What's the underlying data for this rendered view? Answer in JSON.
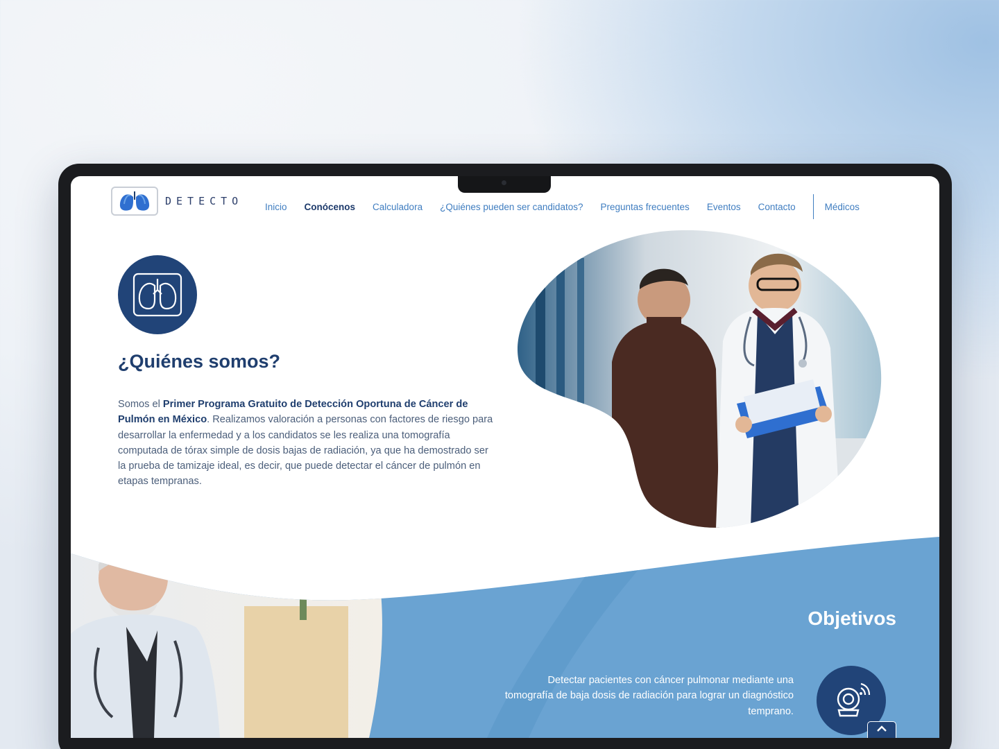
{
  "nav": {
    "brand": "DETECTO",
    "items": [
      {
        "label": "Inicio",
        "active": false
      },
      {
        "label": "Conócenos",
        "active": true
      },
      {
        "label": "Calculadora",
        "active": false
      },
      {
        "label": "¿Quiénes pueden ser candidatos?",
        "active": false
      },
      {
        "label": "Preguntas frecuentes",
        "active": false
      },
      {
        "label": "Eventos",
        "active": false
      },
      {
        "label": "Contacto",
        "active": false
      }
    ],
    "medicos": "Médicos"
  },
  "about": {
    "icon": "lungs-icon",
    "title": "¿Quiénes somos?",
    "text_intro": "Somos el ",
    "text_bold": "Primer Programa Gratuito de Detección Oportuna de Cáncer de Pulmón en México",
    "text_rest": ". Realizamos valoración a personas con factores de riesgo para desarrollar la enfermedad y a los candidatos se les realiza una tomografía computada de tórax simple de dosis bajas de radiación, ya que ha demostrado ser la prueba de tamizaje ideal, es decir, que puede detectar el cáncer de pulmón en etapas tempranas."
  },
  "objetivos": {
    "title": "Objetivos",
    "text": "Detectar pacientes con cáncer pulmonar mediante una tomografía de baja dosis de radiación para lograr un diagnóstico temprano.",
    "icon": "ct-scanner-icon"
  },
  "scroll_top": {
    "icon": "chevron-up-icon"
  },
  "colors": {
    "primary": "#214478",
    "link": "#3f7dc0",
    "heading": "#1f3e6e",
    "section_blue": "#6aa3d2"
  }
}
